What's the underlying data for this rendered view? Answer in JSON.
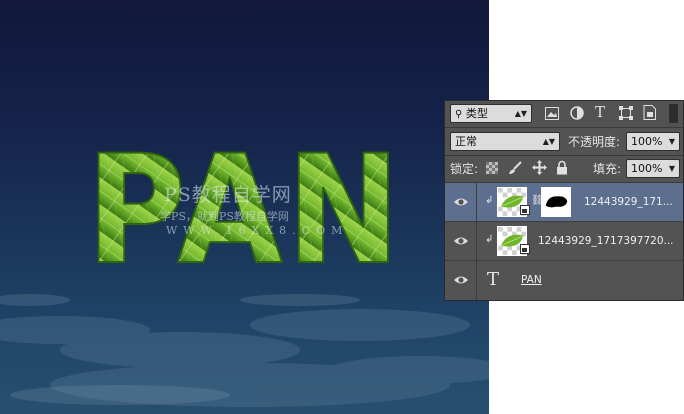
{
  "canvas": {
    "art_text": "PAN",
    "watermark": {
      "line1": "PS教程自学网",
      "line2": "学PS，就到PS教程自学网",
      "line3": "WWW.16XX8.COM"
    },
    "colors": {
      "leaf_light": "#9fd44a",
      "leaf_mid": "#6fb52c",
      "leaf_dark": "#3c7a14"
    }
  },
  "layers_panel": {
    "filter_kind": "类型",
    "filter_icons": [
      "image-filter-icon",
      "adjustment-filter-icon",
      "type-filter-icon",
      "shape-filter-icon",
      "smart-object-filter-icon"
    ],
    "blend_mode": "正常",
    "opacity_label": "不透明度:",
    "opacity_value": "100%",
    "lock_label": "锁定:",
    "fill_label": "填充:",
    "fill_value": "100%",
    "layers": [
      {
        "name": "12443929_171...",
        "selected": true,
        "clipped": true,
        "has_mask": true
      },
      {
        "name": "12443929_1717397720...",
        "selected": false,
        "clipped": true,
        "has_mask": false
      },
      {
        "name": "PAN",
        "selected": false,
        "type": "text"
      }
    ],
    "colors": {
      "panel_bg": "#535353",
      "selected_row": "#5d6f8f"
    }
  }
}
